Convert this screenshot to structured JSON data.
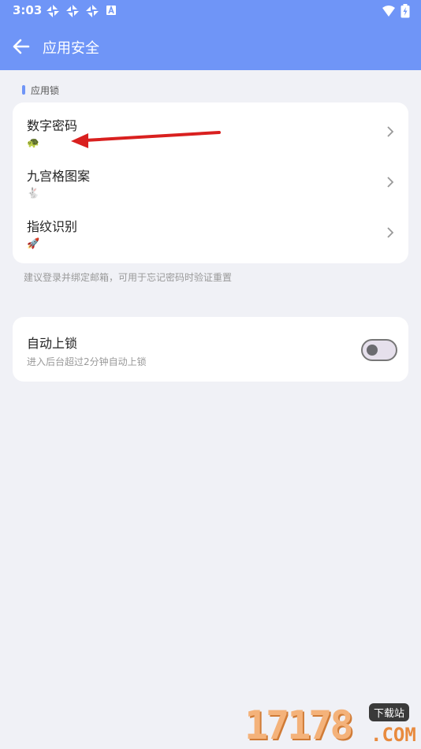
{
  "status_bar": {
    "time": "3:03",
    "left_icons": [
      "sync-icon",
      "sync-icon",
      "sync-icon",
      "a-badge-icon"
    ],
    "right_icons": [
      "wifi-icon",
      "battery-charging-icon"
    ]
  },
  "header": {
    "title": "应用安全",
    "back_icon": "arrow-left-icon",
    "background": "#6f95f7"
  },
  "section": {
    "label": "应用锁"
  },
  "lock_items": [
    {
      "title": "数字密码",
      "emoji": "🐢"
    },
    {
      "title": "九宫格图案",
      "emoji": "🐇"
    },
    {
      "title": "指纹识别",
      "emoji": "🚀"
    }
  ],
  "hint": "建议登录并绑定邮箱，可用于忘记密码时验证重置",
  "auto_lock": {
    "title": "自动上锁",
    "subtitle": "进入后台超过2分钟自动上锁",
    "enabled": false
  },
  "watermark": {
    "digits": "17178",
    "tag": "下载站",
    "com": ".COM"
  },
  "colors": {
    "accent": "#6f95f7",
    "background": "#f0f1f6",
    "annotation_arrow": "#d9201f"
  }
}
